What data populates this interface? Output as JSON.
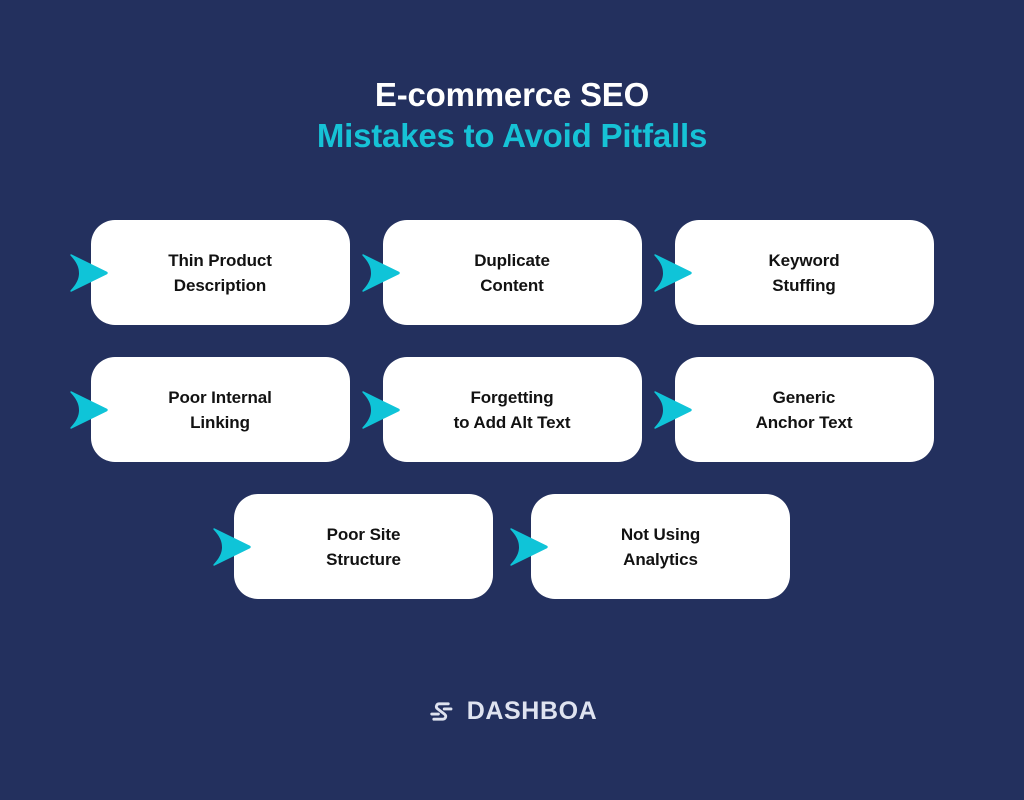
{
  "theme": {
    "background": "#23305e",
    "accent_cyan": "#16c2d6",
    "card_background": "#ffffff",
    "card_text": "#121212",
    "title_white": "#ffffff",
    "logo_text_color": "#dfe3f0"
  },
  "title": {
    "line1": "E-commerce SEO",
    "line2": "Mistakes to Avoid Pitfalls"
  },
  "rows": [
    {
      "cards": [
        {
          "label": "Thin Product\nDescription",
          "arrow_icon": "arrow-right-icon"
        },
        {
          "label": "Duplicate\nContent",
          "arrow_icon": "arrow-right-icon"
        },
        {
          "label": "Keyword\nStuffing",
          "arrow_icon": "arrow-right-icon"
        }
      ]
    },
    {
      "cards": [
        {
          "label": "Poor Internal\nLinking",
          "arrow_icon": "arrow-right-icon"
        },
        {
          "label": "Forgetting\nto Add Alt Text",
          "arrow_icon": "arrow-right-icon"
        },
        {
          "label": "Generic\nAnchor Text",
          "arrow_icon": "arrow-right-icon"
        }
      ]
    },
    {
      "cards": [
        {
          "label": "Poor Site\nStructure",
          "arrow_icon": "arrow-right-icon"
        },
        {
          "label": "Not Using\nAnalytics",
          "arrow_icon": "arrow-right-icon"
        }
      ]
    }
  ],
  "footer": {
    "logo_icon": "dashboa-logo-icon",
    "brand_name": "DASHBOA"
  }
}
